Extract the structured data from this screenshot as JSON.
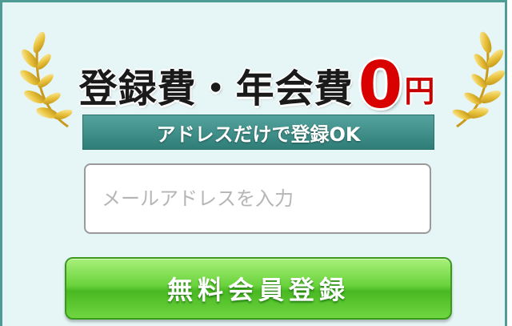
{
  "promo": {
    "headline_main": "登録費・年会費",
    "headline_zero": "0",
    "headline_yen": "円",
    "subtitle": "アドレスだけで登録OK"
  },
  "form": {
    "email_placeholder": "メールアドレスを入力",
    "email_value": "",
    "register_label": "無料会員登録"
  },
  "colors": {
    "frame_border": "#4f9b96",
    "background": "#e6f5f6",
    "banner": "#3f8f89",
    "price_red": "#d90000",
    "button_green": "#5cc92e",
    "laurel_gold": "#e0b52c"
  },
  "icons": {
    "left": "laurel-left-icon",
    "right": "laurel-right-icon"
  }
}
